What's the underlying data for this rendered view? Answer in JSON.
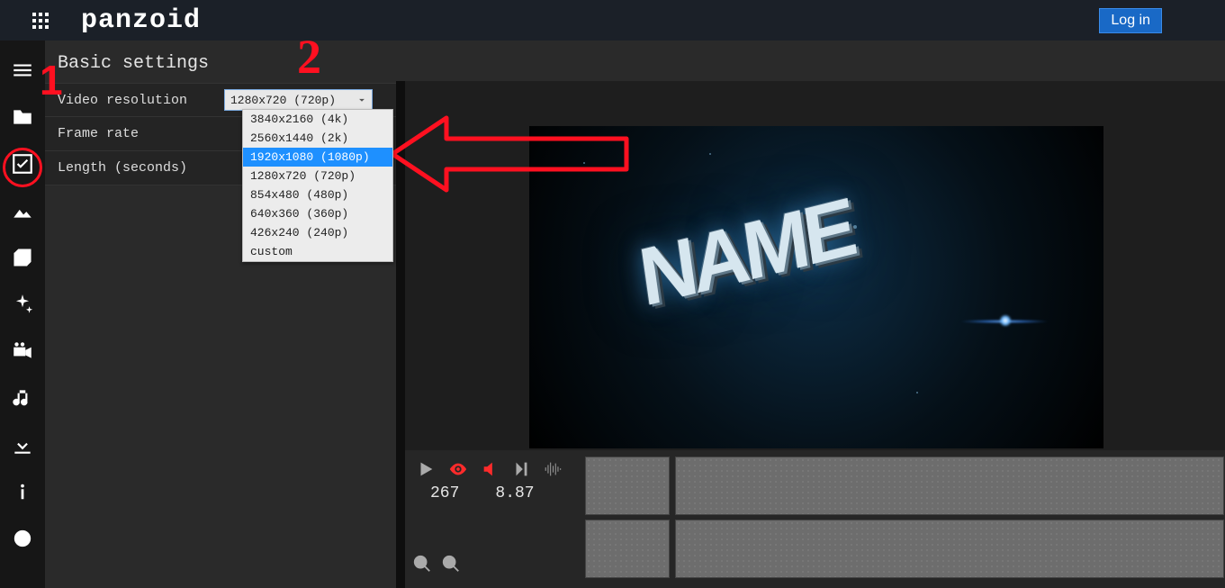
{
  "topbar": {
    "logo": "panzoid",
    "login_label": "Log in"
  },
  "sidebar_tools": [
    "menu",
    "folder",
    "checkbox",
    "image",
    "cube",
    "sparkle",
    "camera",
    "music",
    "download",
    "info",
    "smile"
  ],
  "settings": {
    "title": "Basic settings",
    "rows": {
      "resolution_label": "Video resolution",
      "framerate_label": "Frame rate",
      "length_label": "Length (seconds)"
    },
    "resolution_selected": "1280x720 (720p)",
    "resolution_options": [
      "3840x2160 (4k)",
      "2560x1440 (2k)",
      "1920x1080 (1080p)",
      "1280x720 (720p)",
      "854x480 (480p)",
      "640x360 (360p)",
      "426x240 (240p)",
      "custom"
    ],
    "resolution_highlight_index": 2
  },
  "preview": {
    "text3d": "NAME"
  },
  "playback": {
    "frame": "267",
    "time": "8.87"
  },
  "annotations": {
    "label1": "1",
    "label2": "2"
  }
}
